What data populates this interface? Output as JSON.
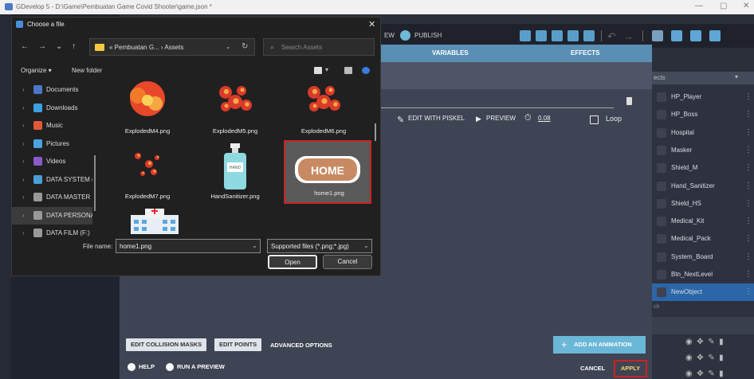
{
  "window": {
    "title": "GDevelop 5 - D:\\Game\\Pembuatan Game Covid Shooter\\game.json *",
    "controls": [
      "—",
      "▢",
      "✕"
    ]
  },
  "toolbar": {
    "preview_partial": "EW",
    "publish": "PUBLISH"
  },
  "editor": {
    "tabs": {
      "variables": "VARIABLES",
      "effects": "EFFECTS"
    },
    "anim": {
      "edit_piskel": "EDIT WITH PISKEL",
      "preview": "PREVIEW",
      "timing": "0.08",
      "loop": "Loop"
    },
    "bottom": {
      "collision_masks": "EDIT COLLISION MASKS",
      "edit_points": "EDIT POINTS",
      "advanced": "ADVANCED OPTIONS",
      "add_animation": "ADD AN ANIMATION",
      "help": "HELP",
      "run_preview": "RUN A PREVIEW",
      "cancel": "CANCEL",
      "apply": "APPLY"
    }
  },
  "objects_panel": {
    "header": "ects",
    "items": [
      "HP_Player",
      "HP_Boss",
      "Hospital",
      "Masker",
      "Shield_M",
      "Hand_Sanitizer",
      "Shield_HS",
      "Medical_Kit",
      "Medical_Pack",
      "System_Board",
      "Btn_NextLevel",
      "NewObject"
    ],
    "search_partial": "ch"
  },
  "dialog": {
    "title": "Choose a file",
    "nav_icons": [
      "←",
      "→",
      "⌄",
      "↑"
    ],
    "path": "« Pembuatan G... › Assets",
    "search_placeholder": "Search Assets",
    "organize": "Organize ▾",
    "new_folder": "New folder",
    "sidebar": [
      {
        "label": "Documents",
        "color": "#4a78c9"
      },
      {
        "label": "Downloads",
        "color": "#3aa0e0"
      },
      {
        "label": "Music",
        "color": "#e05a3a"
      },
      {
        "label": "Pictures",
        "color": "#4aa3e0"
      },
      {
        "label": "Videos",
        "color": "#8a5ac9"
      },
      {
        "label": "DATA SYSTEM (",
        "color": "#4a9fd9"
      },
      {
        "label": "DATA MASTER (",
        "color": "#999999"
      },
      {
        "label": "DATA PERSONA",
        "color": "#999999"
      },
      {
        "label": "DATA FILM (F:)",
        "color": "#999999"
      }
    ],
    "files": [
      {
        "name": "ExplodedM4.png"
      },
      {
        "name": "ExplodedM5.png"
      },
      {
        "name": "ExplodedM6.png"
      },
      {
        "name": "ExplodedM7.png"
      },
      {
        "name": "HandSanitizer.png",
        "badge": "HAND"
      },
      {
        "name": "home1.png",
        "badge": "HOME"
      }
    ],
    "file_name_label": "File name:",
    "file_name_value": "home1.png",
    "file_type": "Supported files (*.png;*.jpg)",
    "open": "Open",
    "cancel": "Cancel"
  }
}
